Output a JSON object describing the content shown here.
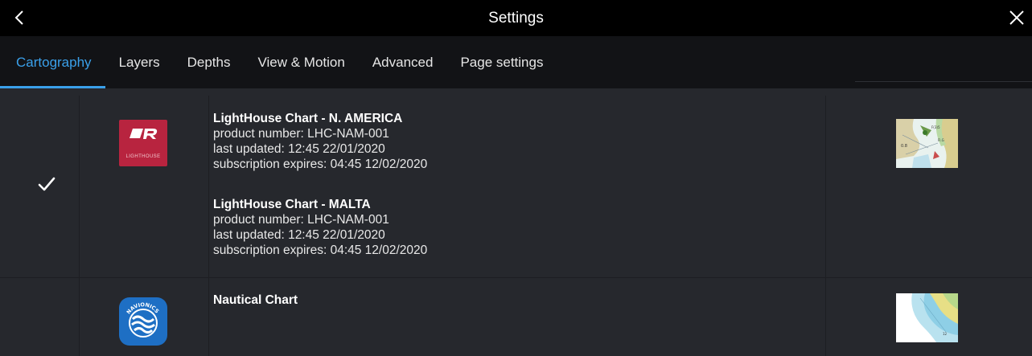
{
  "header": {
    "title": "Settings",
    "back_icon": "chevron-left-icon",
    "close_icon": "close-icon"
  },
  "tabs": [
    {
      "label": "Cartography",
      "active": true
    },
    {
      "label": "Layers",
      "active": false
    },
    {
      "label": "Depths",
      "active": false
    },
    {
      "label": "View & Motion",
      "active": false
    },
    {
      "label": "Advanced",
      "active": false
    },
    {
      "label": "Page settings",
      "active": false
    }
  ],
  "colors": {
    "accent": "#3aa0ea",
    "titlebar": "#000000",
    "tabbar": "#121316",
    "panel": "#26282d",
    "lighthouse_red": "#b8243f",
    "navionics_blue": "#1e6fc4"
  },
  "cartography": {
    "providers": [
      {
        "selected": true,
        "selected_icon": "checkmark-icon",
        "logo": "lighthouse-logo",
        "logo_text": "LIGHTHOUSE",
        "thumbnail": "lighthouse-chart-thumbnail",
        "charts": [
          {
            "name": "LightHouse Chart - N. AMERICA",
            "product_number": "product number: LHC-NAM-001",
            "last_updated": "last updated: 12:45 22/01/2020",
            "subscription": "subscription expires: 04:45 12/02/2020"
          },
          {
            "name": "LightHouse Chart - MALTA",
            "product_number": "product number: LHC-NAM-001",
            "last_updated": "last updated: 12:45 22/01/2020",
            "subscription": "subscription expires: 04:45 12/02/2020"
          }
        ]
      },
      {
        "selected": false,
        "logo": "navionics-logo",
        "logo_text": "NAVIONICS",
        "thumbnail": "nautical-chart-thumbnail",
        "charts": [
          {
            "name": "Nautical Chart"
          }
        ]
      }
    ]
  }
}
